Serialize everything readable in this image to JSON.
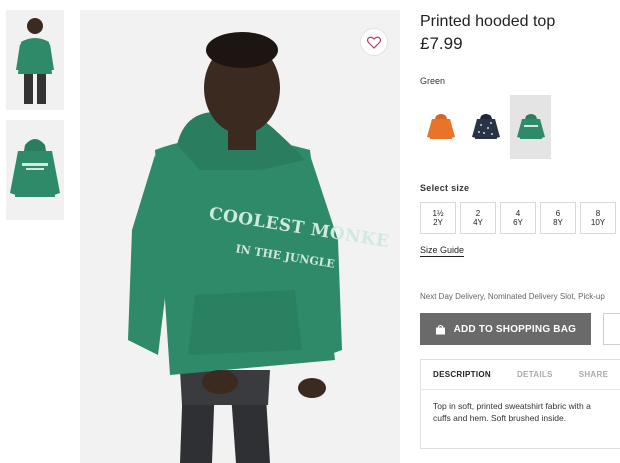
{
  "product": {
    "title": "Printed hooded top",
    "price": "£7.99"
  },
  "hoodie_print": {
    "line1": "COOLEST MONKE",
    "line2": "IN THE JUNGLE"
  },
  "thumbnails": [
    {
      "icon": "model-photo"
    },
    {
      "icon": "hoodie-photo"
    }
  ],
  "color": {
    "label": "Green",
    "swatches": [
      {
        "name": "orange",
        "color": "#e8742a",
        "selected": false
      },
      {
        "name": "navy",
        "color": "#2a3346",
        "selected": false
      },
      {
        "name": "green",
        "color": "#2e8a68",
        "selected": true
      }
    ]
  },
  "size": {
    "label": "Select size",
    "options": [
      {
        "top": "1½",
        "bottom": "2Y"
      },
      {
        "top": "2",
        "bottom": "4Y"
      },
      {
        "top": "4",
        "bottom": "6Y"
      },
      {
        "top": "6",
        "bottom": "8Y"
      },
      {
        "top": "8",
        "bottom": "10Y"
      }
    ],
    "guide_label": "Size Guide"
  },
  "delivery_text": "Next Day Delivery, Nominated Delivery Slot, Pick-up",
  "actions": {
    "add_label": "ADD TO SHOPPING BAG"
  },
  "tabs": [
    {
      "label": "DESCRIPTION",
      "active": true
    },
    {
      "label": "DETAILS",
      "active": false
    },
    {
      "label": "SHARE",
      "active": false
    }
  ],
  "description": {
    "line1": "Top in soft, printed sweatshirt fabric with a",
    "line2": "cuffs and hem. Soft brushed inside."
  },
  "colors": {
    "hoodie": "#2e8a68",
    "button": "#6a6a6a"
  }
}
